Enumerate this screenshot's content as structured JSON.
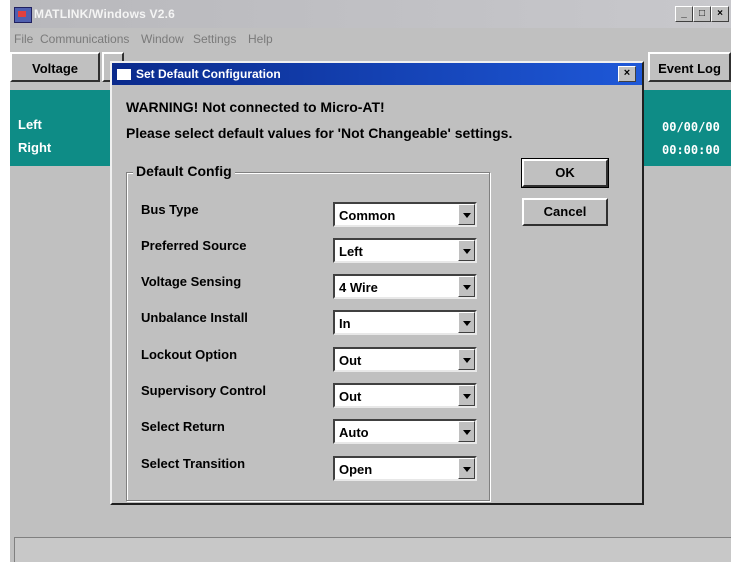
{
  "window": {
    "title": "MATLINK/Windows V2.6",
    "controls": [
      "_",
      "□",
      "×"
    ]
  },
  "menu": [
    "File",
    "Communications",
    "Window",
    "Settings",
    "Help"
  ],
  "toolbar": {
    "voltage": "Voltage",
    "event_log": "Event Log"
  },
  "status_panel": {
    "left_label": "Left",
    "right_label": "Right",
    "date_value": "00/00/00",
    "time_value": "00:00:00"
  },
  "dialog": {
    "title": "Set Default Configuration",
    "close": "×",
    "warning_line1": "WARNING! Not connected to Micro-AT!",
    "warning_line2": "Please select default values for 'Not Changeable' settings.",
    "group_label": "Default Config",
    "ok_label": "OK",
    "cancel_label": "Cancel",
    "fields": [
      {
        "label": "Bus Type",
        "value": "Common"
      },
      {
        "label": "Preferred Source",
        "value": "Left"
      },
      {
        "label": "Voltage Sensing",
        "value": "4 Wire"
      },
      {
        "label": "Unbalance Install",
        "value": "In"
      },
      {
        "label": "Lockout Option",
        "value": "Out"
      },
      {
        "label": "Supervisory Control",
        "value": "Out"
      },
      {
        "label": "Select Return",
        "value": "Auto"
      },
      {
        "label": "Select Transition",
        "value": "Open"
      }
    ]
  }
}
